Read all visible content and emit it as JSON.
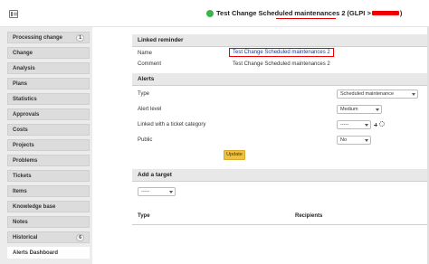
{
  "header": {
    "title_prefix": "Test Change Scheduled",
    "title_highlight": "maintenances 2",
    "title_suffix": "(GLPI >",
    "title_end": ")"
  },
  "sidebar": {
    "items": [
      {
        "label": "Processing change",
        "badge": "1"
      },
      {
        "label": "Change",
        "badge": ""
      },
      {
        "label": "Analysis",
        "badge": ""
      },
      {
        "label": "Plans",
        "badge": ""
      },
      {
        "label": "Statistics",
        "badge": ""
      },
      {
        "label": "Approvals",
        "badge": ""
      },
      {
        "label": "Costs",
        "badge": ""
      },
      {
        "label": "Projects",
        "badge": ""
      },
      {
        "label": "Problems",
        "badge": ""
      },
      {
        "label": "Tickets",
        "badge": ""
      },
      {
        "label": "Items",
        "badge": ""
      },
      {
        "label": "Knowledge base",
        "badge": ""
      },
      {
        "label": "Notes",
        "badge": ""
      },
      {
        "label": "Historical",
        "badge": "6"
      },
      {
        "label": "Alerts Dashboard",
        "badge": ""
      }
    ]
  },
  "linked_reminder": {
    "title": "Linked reminder",
    "name_label": "Name",
    "name_value": "Test Change Scheduled maintenances 2",
    "comment_label": "Comment",
    "comment_value": "Test Change Scheduled maintenances 2"
  },
  "alerts": {
    "title": "Alerts",
    "type_label": "Type",
    "type_value": "Scheduled maintenance",
    "level_label": "Alert level",
    "level_value": "Medium",
    "ticket_label": "Linked with a ticket category",
    "ticket_value": "-----",
    "public_label": "Public",
    "public_value": "No",
    "update_label": "Update"
  },
  "add_target": {
    "title": "Add a target",
    "select_value": "-----"
  },
  "targets_table": {
    "columns": [
      "Type",
      "Recipients"
    ]
  },
  "colors": {
    "status_dot": "#3cb44a",
    "highlight_border": "#e00000",
    "update_button": "#f0c040"
  }
}
